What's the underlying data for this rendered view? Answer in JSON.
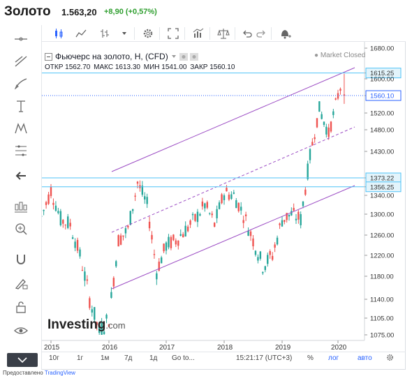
{
  "header": {
    "title": "Золото",
    "price": "1.563,20",
    "change": "+8,90 (+0,57%)"
  },
  "legend": {
    "symbol": "Фьючерс на золото, H, (CFD)",
    "open_label": "ОТКР",
    "open": "1562.70",
    "high_label": "МАКС",
    "high": "1613.30",
    "low_label": "МИН",
    "low": "1541.00",
    "close_label": "ЗАКР",
    "close": "1560.10",
    "market_status": "Market Closed"
  },
  "price_axis": [
    "1680.00",
    "1615.25",
    "1600.00",
    "1560.10",
    "1520.00",
    "1480.00",
    "1430.00",
    "1373.22",
    "1356.25",
    "1340.00",
    "1300.00",
    "1260.00",
    "1220.00",
    "1180.00",
    "1140.00",
    "1105.00",
    "1075.00"
  ],
  "price_markers": [
    {
      "label": "1615.25"
    },
    {
      "label": "1560.10"
    },
    {
      "label": "1373.22"
    },
    {
      "label": "1356.25"
    }
  ],
  "time_axis": [
    "2015",
    "2016",
    "2017",
    "2018",
    "2019",
    "2020"
  ],
  "bottom": {
    "ranges": [
      "10г",
      "1г",
      "1м",
      "7д",
      "1д"
    ],
    "goto": "Go to...",
    "time": "15:21:17 (UTC+3)",
    "percent": "%",
    "log": "лог",
    "auto": "авто"
  },
  "logo": {
    "name": "Investing",
    "suffix": ".com"
  },
  "credit": {
    "text": "Предоставлено",
    "link": "TradingView"
  },
  "colors": {
    "up": "#26a69a",
    "down": "#ef5350",
    "channel": "#9c4dc4",
    "level": "#4fc3f7",
    "accent": "#2962ff"
  },
  "chart_data": {
    "type": "line",
    "x": [
      "2014-11",
      "2015-01",
      "2015-03",
      "2015-05",
      "2015-07",
      "2015-09",
      "2015-11",
      "2016-01",
      "2016-03",
      "2016-05",
      "2016-07",
      "2016-09",
      "2016-11",
      "2017-01",
      "2017-03",
      "2017-05",
      "2017-07",
      "2017-09",
      "2017-11",
      "2018-01",
      "2018-03",
      "2018-05",
      "2018-07",
      "2018-09",
      "2018-11",
      "2019-01",
      "2019-03",
      "2019-05",
      "2019-07",
      "2019-09",
      "2019-11",
      "2020-01",
      "2020-02"
    ],
    "series": [
      {
        "values": [
          1295,
          1350,
          1290,
          1280,
          1220,
          1140,
          1080,
          1105,
          1250,
          1270,
          1365,
          1320,
          1190,
          1240,
          1250,
          1270,
          1290,
          1320,
          1280,
          1345,
          1340,
          1300,
          1250,
          1200,
          1220,
          1290,
          1300,
          1290,
          1420,
          1530,
          1470,
          1560,
          1600
        ]
      }
    ],
    "ylim": [
      1075,
      1680
    ],
    "ytick_labels": [
      "1680.00",
      "1600.00",
      "1520.00",
      "1480.00",
      "1430.00",
      "1340.00",
      "1300.00",
      "1260.00",
      "1220.00",
      "1180.00",
      "1140.00",
      "1105.00",
      "1075.00"
    ],
    "xtick_labels": [
      "2015",
      "2016",
      "2017",
      "2018",
      "2019",
      "2020"
    ],
    "grid": false
  }
}
